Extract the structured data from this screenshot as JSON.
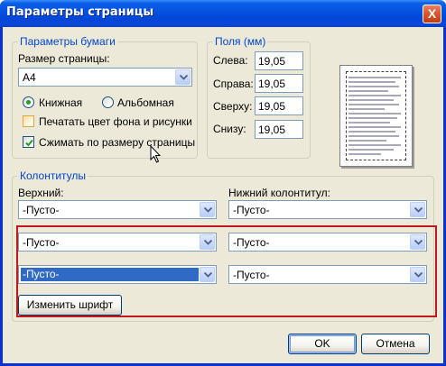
{
  "window": {
    "title": "Параметры страницы",
    "close_glyph": "X"
  },
  "paper": {
    "group_label": "Параметры бумаги",
    "size_label": "Размер страницы:",
    "size_value": "A4",
    "orientation": {
      "portrait_label": "Книжная",
      "landscape_label": "Альбомная",
      "selected": "portrait"
    },
    "print_background_label": "Печатать цвет фона и рисунки",
    "print_background_checked": false,
    "shrink_label": "Сжимать по размеру страницы",
    "shrink_checked": true
  },
  "margins": {
    "group_label": "Поля (мм)",
    "fields": [
      {
        "label": "Слева:",
        "value": "19,05"
      },
      {
        "label": "Справа:",
        "value": "19,05"
      },
      {
        "label": "Сверху:",
        "value": "19,05"
      },
      {
        "label": "Снизу:",
        "value": "19,05"
      }
    ]
  },
  "headers_footers": {
    "group_label": "Колонтитулы",
    "header_label": "Верхний:",
    "footer_label": "Нижний колонтитул:",
    "header_values": [
      "-Пусто-",
      "-Пусто-",
      "-Пусто-"
    ],
    "footer_values": [
      "-Пусто-",
      "-Пусто-",
      "-Пусто-"
    ],
    "selected_header_index": 2
  },
  "buttons": {
    "change_font": "Изменить шрифт",
    "ok": "OK",
    "cancel": "Отмена"
  },
  "colors": {
    "group_label": "#0046d5",
    "highlight": "#c0181e",
    "selection": "#316ac5"
  }
}
